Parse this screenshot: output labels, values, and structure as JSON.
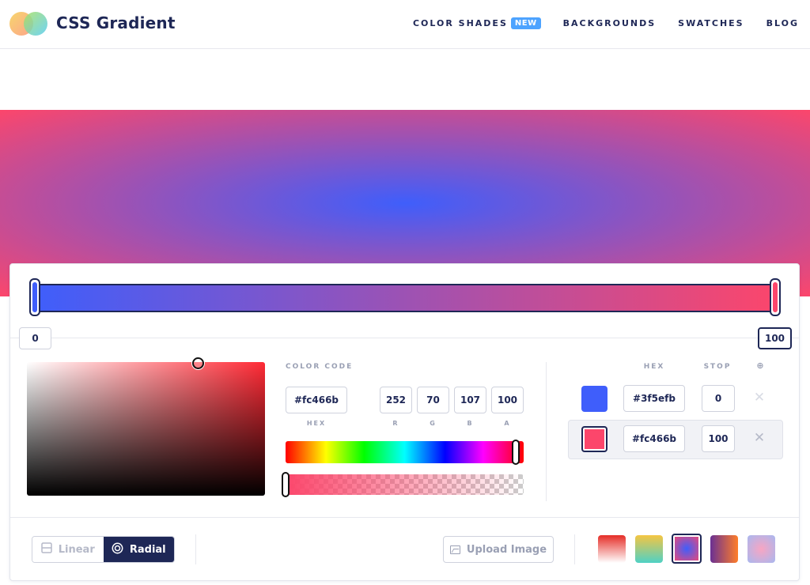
{
  "header": {
    "brand": "CSS Gradient",
    "nav": [
      {
        "label": "COLOR SHADES",
        "badge": "NEW"
      },
      {
        "label": "BACKGROUNDS"
      },
      {
        "label": "SWATCHES"
      },
      {
        "label": "BLOG"
      }
    ]
  },
  "gradient": {
    "type": "radial",
    "colors": [
      "#3f5efb",
      "#fc466b"
    ]
  },
  "stops_bar": {
    "left_label": "0",
    "right_label": "100"
  },
  "picker": {
    "label": "COLOR CODE",
    "hex": "#fc466b",
    "r": "252",
    "g": "70",
    "b": "107",
    "a": "100",
    "captions": {
      "hex": "HEX",
      "r": "R",
      "g": "G",
      "b": "B",
      "a": "A"
    }
  },
  "stops_table": {
    "headers": {
      "hex": "HEX",
      "stop": "STOP",
      "add": "⊕"
    },
    "rows": [
      {
        "color": "#3f5efb",
        "hex": "#3f5efb",
        "stop": "0",
        "selected": false
      },
      {
        "color": "#fc466b",
        "hex": "#fc466b",
        "stop": "100",
        "selected": true
      }
    ],
    "remove_glyph": "✕"
  },
  "controls": {
    "linear_label": "Linear",
    "radial_label": "Radial",
    "upload_label": "Upload Image"
  },
  "presets": [
    {
      "name": "red-white",
      "selected": false
    },
    {
      "name": "yellow-teal",
      "selected": false
    },
    {
      "name": "blue-pink-radial",
      "selected": true
    },
    {
      "name": "purple-orange",
      "selected": false
    },
    {
      "name": "lavender-pink-radial",
      "selected": false
    }
  ]
}
